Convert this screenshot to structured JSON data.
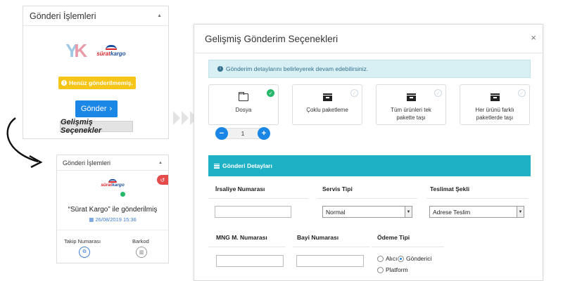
{
  "left_panel": {
    "title": "Gönderi İşlemleri",
    "warning": "Henüz gönderilmemiş.",
    "send_button": "Gönder",
    "advanced_label": "Gelişmiş Seçenekler",
    "logo_sk_part1": "sürat",
    "logo_sk_part2": "kargo"
  },
  "small_panel": {
    "title": "Gönderi İşlemleri",
    "logo_part1": "sürat",
    "logo_part2": "kargo",
    "sent_title": "“Sürat Kargo” ile gönderilmiş",
    "sent_date": "26/08/2019 15:36",
    "tracking_label": "Takip Numarası",
    "barcode_label": "Barkod"
  },
  "modal": {
    "title": "Gelişmiş Gönderim Seçenekleri",
    "close": "×",
    "info": "Gönderim detaylarını belirleyerek devam edebilirsiniz.",
    "options": [
      {
        "label": "Dosya",
        "selected": true
      },
      {
        "label": "Çoklu paketleme",
        "selected": false
      },
      {
        "label": "Tüm ürünleri tek pakette taşı",
        "selected": false
      },
      {
        "label": "Her ürünü farklı paketlerde taşı",
        "selected": false
      }
    ],
    "stepper": {
      "minus": "−",
      "value": "1",
      "plus": "+"
    },
    "section_title": "Gönderi Detayları",
    "fields": {
      "waybill_label": "İrsaliye Numarası",
      "service_label": "Servis Tipi",
      "service_value": "Normal",
      "delivery_label": "Teslimat Şekli",
      "delivery_value": "Adrese Teslim",
      "mng_label": "MNG M. Numarası",
      "dealer_label": "Bayi Numarası",
      "payment_label": "Ödeme Tipi",
      "payment_options": [
        "Alıcı",
        "Gönderici",
        "Platform"
      ]
    }
  },
  "colors": {
    "primary": "#1a86e5",
    "warning": "#f5c518",
    "info_bg": "#d8f0f4",
    "section": "#1eb0c5",
    "success": "#27b86a",
    "danger": "#e54b4b"
  }
}
